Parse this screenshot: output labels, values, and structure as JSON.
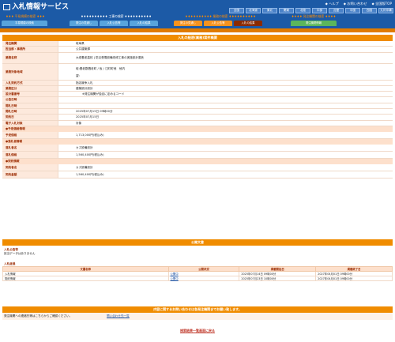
{
  "header": {
    "title": "入札情報サービス",
    "links": [
      "ヘルプ",
      "お問い合わせ",
      "全国版TOP"
    ],
    "regions": [
      "全国",
      "北海道",
      "東北",
      "関東",
      "北陸",
      "中部",
      "近畿",
      "中国",
      "四国",
      "九州沖縄"
    ],
    "groups": [
      {
        "title": "♦♦♦ 平易規模の検索 ♦♦♦",
        "tabs": [
          "平易規模の検索"
        ]
      },
      {
        "title": "♦♦♦♦♦♦♦♦♦♦ 工事の検索 ♦♦♦♦♦♦♦♦♦♦",
        "tabs": [
          "発注の見通し",
          "入札公告等",
          "入札の結果"
        ]
      },
      {
        "title": "♦♦♦♦♦♦♦♦♦♦ 業務の検索 ♦♦♦♦♦♦♦♦♦♦",
        "tabs": [
          "発注の見通し",
          "入札公告等",
          "入札の結果"
        ]
      },
      {
        "title": "♦♦♦♦ 発注機関の検索 ♦♦♦♦",
        "tabs": [
          "発注機関情報"
        ]
      }
    ],
    "colors": {
      "navy": "#1c5aa6",
      "orange": "#f08c00",
      "brown": "#8b2a00"
    }
  },
  "detail": {
    "title": "入札の経過(業務)案件概要",
    "rows": [
      {
        "label": "発注機関",
        "value": "岐阜県"
      },
      {
        "label": "担当部・事務所",
        "value": "公共建築課"
      },
      {
        "label": "業務名称",
        "value": "大垣養老高校 | 防災受電設備改修工事の実施設計委託"
      },
      {
        "label": "業務対象地域",
        "value": "岐:養老郡養老町 / 仮 / 江町町他　他内",
        "value2": "望:"
      },
      {
        "label": "入札契約方式",
        "value": "指名競争入札"
      },
      {
        "label": "業務区分",
        "value": "建築設計設計"
      },
      {
        "label": "設計書番号",
        "value": "※発注機関が独自に定めるコード"
      },
      {
        "label": "公告日時",
        "value": ""
      },
      {
        "label": "開札日時",
        "value": ""
      },
      {
        "label": "開札日時",
        "value": "2025年07月15日 09時00分"
      },
      {
        "label": "契約日",
        "value": "2025年07月15日"
      },
      {
        "label": "電子入札対象",
        "value": "対象"
      }
    ],
    "budget_head": "●予定価格情報",
    "budget_rows": [
      {
        "label": "予定価格",
        "value": "1,713,000円(税込み)"
      }
    ],
    "winner_head": "●落札者情報",
    "winner_rows": [
      {
        "label": "落札者名",
        "value": "カズ設備設計"
      },
      {
        "label": "落札価格",
        "value": "1,560,400円(税込み)"
      }
    ],
    "contract_head": "●契約情報",
    "contract_rows": [
      {
        "label": "契約者名",
        "value": "カズ設備設計"
      },
      {
        "label": "契約金額",
        "value": "1,560,400円(税込み)"
      }
    ]
  },
  "documents": {
    "title": "公開文書",
    "notice_head": "入札公告等",
    "notice_empty": "該当データはありません",
    "progress_head": "入札経過",
    "columns": [
      "文書名称",
      "公開状況",
      "掲載開始日",
      "掲載終了日"
    ],
    "rows": [
      {
        "name": "入札情報",
        "status": "公開中",
        "start": "2025年07月14日 09時00分",
        "end": "2027年04月01日 09時00分"
      },
      {
        "name": "契約情報",
        "status": "公開中",
        "start": "2025年07月23日 10時00分",
        "end": "2027年04月01日 09時00分"
      }
    ]
  },
  "contact": {
    "title": "内容に関するお問い合わせは各発注機関までお願い致します。",
    "text": "発注機関への連絡先等はこちらからご確認ください。",
    "link": "問い合わせ先一覧"
  },
  "back_link": "検索結果一覧画面に戻る"
}
